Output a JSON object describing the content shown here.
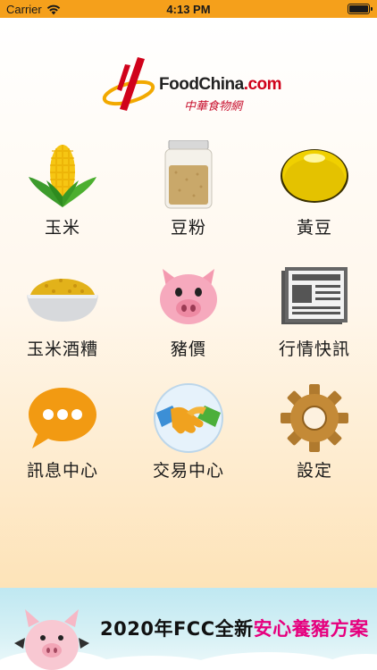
{
  "status_bar": {
    "carrier": "Carrier",
    "time": "4:13 PM",
    "wifi_icon": "wifi-icon",
    "battery_icon": "battery-icon"
  },
  "logo": {
    "brand": "FoodChina",
    "dot_com": ".com",
    "chinese": "中華食物網"
  },
  "menu": [
    {
      "label": "玉米",
      "icon": "corn-icon"
    },
    {
      "label": "豆粉",
      "icon": "soybean-meal-jar-icon"
    },
    {
      "label": "黃豆",
      "icon": "soybean-icon"
    },
    {
      "label": "玉米酒糟",
      "icon": "ddgs-bowl-icon"
    },
    {
      "label": "豬價",
      "icon": "pig-icon"
    },
    {
      "label": "行情快訊",
      "icon": "newspaper-icon"
    },
    {
      "label": "訊息中心",
      "icon": "chat-bubble-icon"
    },
    {
      "label": "交易中心",
      "icon": "handshake-icon"
    },
    {
      "label": "設定",
      "icon": "gear-icon"
    }
  ],
  "banner": {
    "text_prefix": "2020年FCC全新",
    "text_highlight": "安心養豬方案",
    "colors": {
      "highlight": "#e6007e",
      "sky": "#bfe8f2"
    }
  },
  "colors": {
    "status_bar": "#f5a01b",
    "brand_red": "#d0021b"
  }
}
